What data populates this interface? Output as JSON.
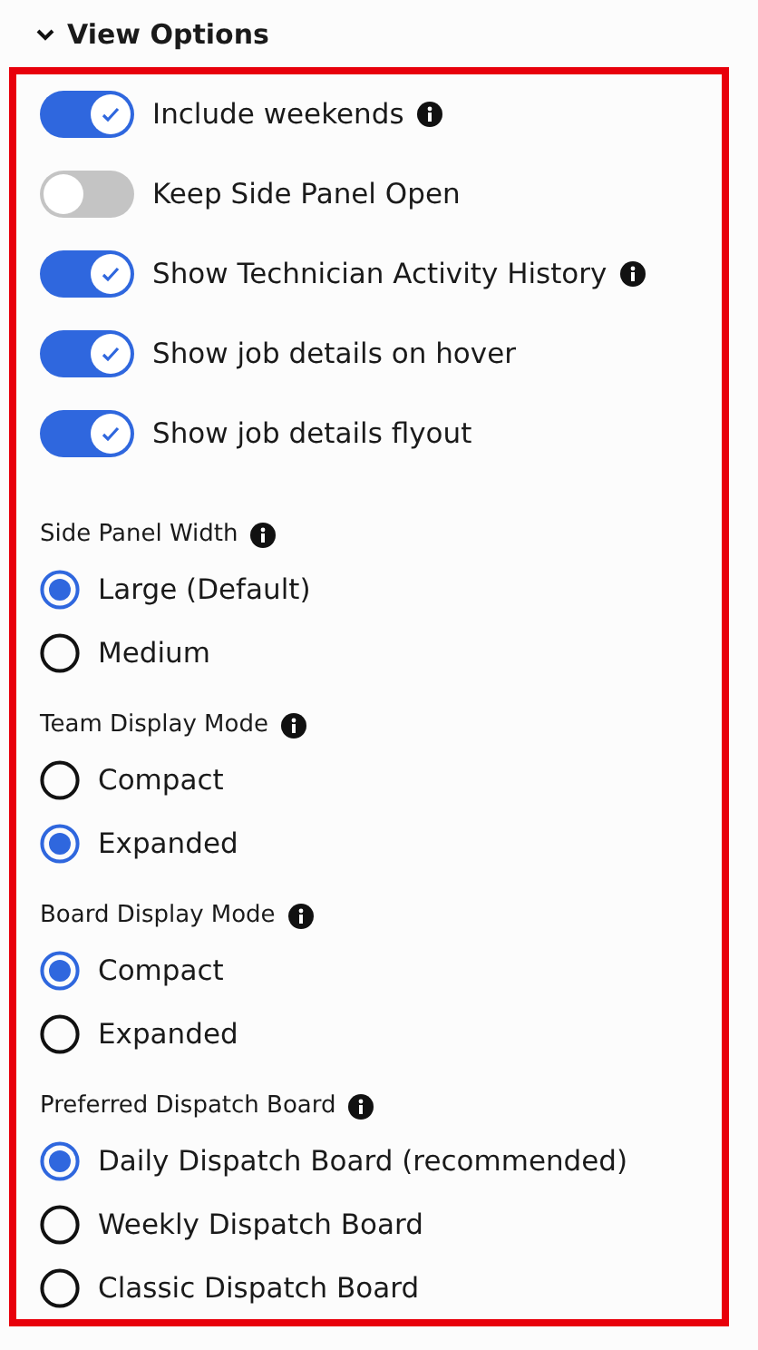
{
  "section": {
    "title": "View Options",
    "expanded": true
  },
  "toggles": [
    {
      "label": "Include weekends",
      "on": true,
      "info": true
    },
    {
      "label": "Keep Side Panel Open",
      "on": false,
      "info": false
    },
    {
      "label": "Show Technician Activity History",
      "on": true,
      "info": true
    },
    {
      "label": "Show job details on hover",
      "on": true,
      "info": false
    },
    {
      "label": "Show job details flyout",
      "on": true,
      "info": false
    }
  ],
  "groups": [
    {
      "title": "Side Panel Width",
      "options": [
        {
          "label": "Large (Default)",
          "selected": true
        },
        {
          "label": "Medium",
          "selected": false
        }
      ]
    },
    {
      "title": "Team Display Mode",
      "options": [
        {
          "label": "Compact",
          "selected": false
        },
        {
          "label": "Expanded",
          "selected": true
        }
      ]
    },
    {
      "title": "Board Display Mode",
      "options": [
        {
          "label": "Compact",
          "selected": true
        },
        {
          "label": "Expanded",
          "selected": false
        }
      ]
    },
    {
      "title": "Preferred Dispatch Board",
      "options": [
        {
          "label": "Daily Dispatch Board (recommended)",
          "selected": true
        },
        {
          "label": "Weekly Dispatch Board",
          "selected": false
        },
        {
          "label": "Classic Dispatch Board",
          "selected": false
        }
      ]
    }
  ]
}
